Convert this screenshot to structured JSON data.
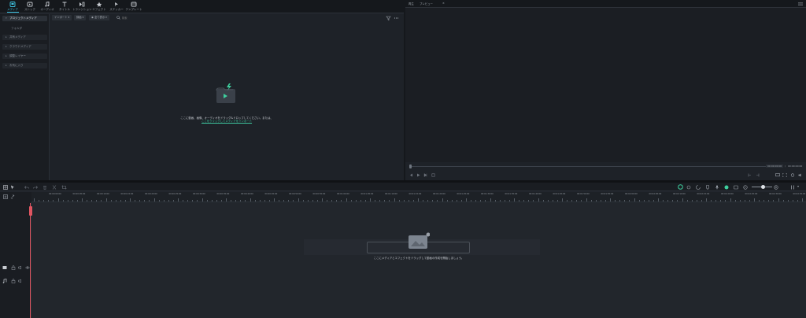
{
  "toolbar": {
    "items": [
      {
        "label": "メディア",
        "icon": "media-icon"
      },
      {
        "label": "ストック",
        "icon": "stock-icon"
      },
      {
        "label": "オーディオ",
        "icon": "audio-icon"
      },
      {
        "label": "タイトル",
        "icon": "title-icon"
      },
      {
        "label": "トランジション",
        "icon": "transition-icon"
      },
      {
        "label": "エフェクト",
        "icon": "effect-icon"
      },
      {
        "label": "ステッカー",
        "icon": "sticker-icon"
      },
      {
        "label": "テンプレート",
        "icon": "template-icon"
      }
    ]
  },
  "sidebar": {
    "project_media": "プロジェクトメディア",
    "folder": "フォルダ",
    "items": [
      "共有メディア",
      "クラウドメディア",
      "調整レイヤー",
      "お気に入り"
    ]
  },
  "media_header": {
    "import_label": "インポート",
    "record_label": "録画",
    "filter_label": "全て表示",
    "search_placeholder": "検索"
  },
  "import": {
    "hint": "ここに動画、画像、オーディオをドラッグ&ドロップしてください。または、",
    "link": "ここをクリックしてメディアをインポート"
  },
  "preview": {
    "tab1": "再生",
    "tab2": "プレビュー",
    "time_current": "00:00:00:00",
    "time_total": "00:00:00:00"
  },
  "timeline": {
    "ticks": [
      "00:00:00:00",
      "00:00:05:00",
      "00:00:10:00",
      "00:00:15:00",
      "00:00:20:00",
      "00:00:25:00",
      "00:00:30:00",
      "00:00:35:00",
      "00:00:40:00",
      "00:00:45:00",
      "00:00:50:00",
      "00:00:55:00",
      "00:01:00:00",
      "00:01:05:00",
      "00:01:10:00",
      "00:01:15:00",
      "00:01:20:00",
      "00:01:25:00",
      "00:01:30:00",
      "00:01:35:00",
      "00:01:40:00",
      "00:01:45:00",
      "00:01:50:00",
      "00:01:55:00",
      "00:02:00:00",
      "00:02:05:00",
      "00:02:10:00",
      "00:02:15:00",
      "00:02:20:00",
      "00:02:25:00",
      "00:02:30:00",
      "00:02:35:00",
      "00:02:40:00"
    ],
    "drop_hint": "ここにメディアとエフェクトをドラッグして動画の作成を開始しましょう。"
  },
  "colors": {
    "accent": "#3ec7e6",
    "link": "#3ec7a0",
    "playhead": "#e05561"
  }
}
